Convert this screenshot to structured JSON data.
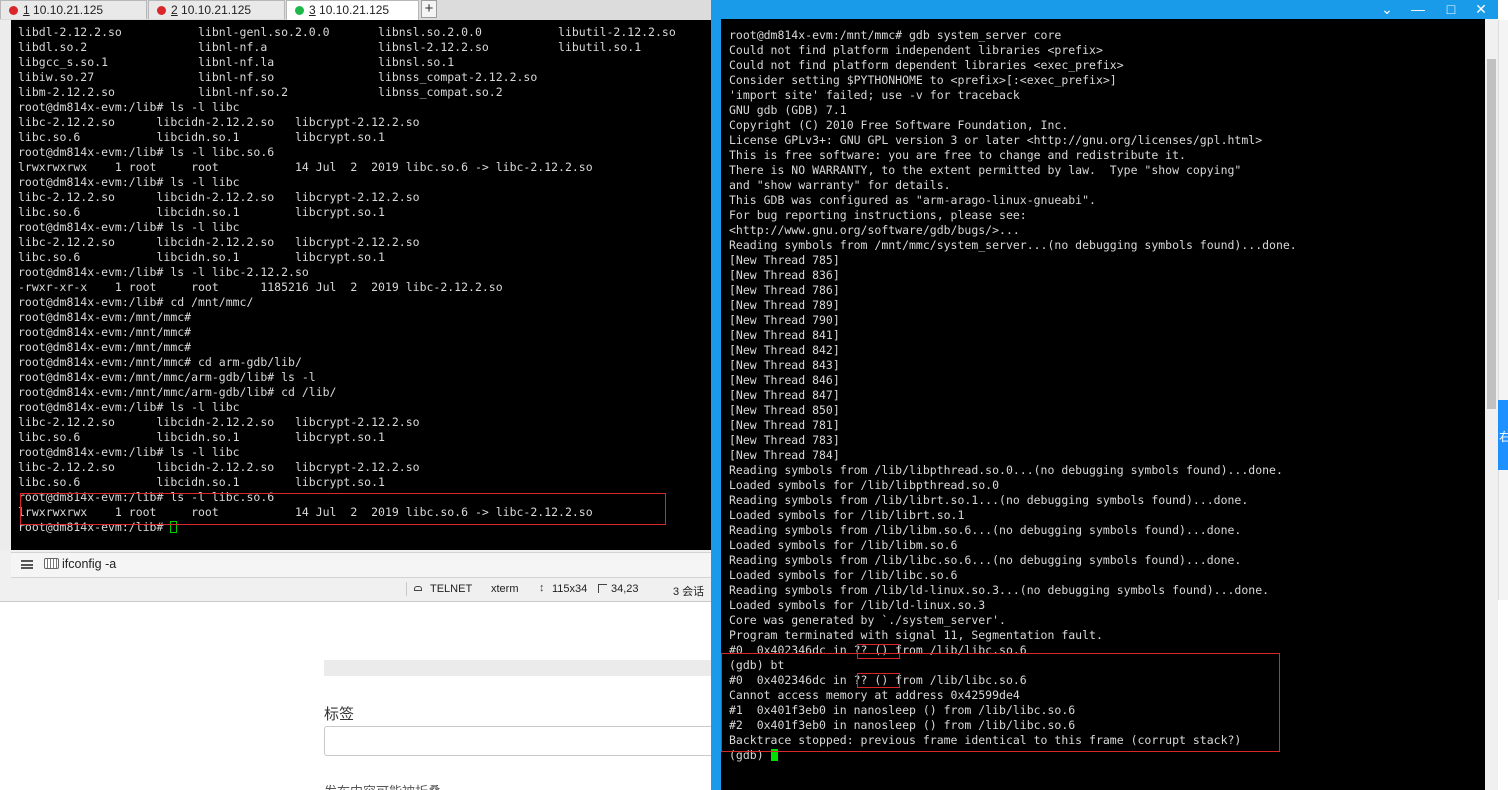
{
  "tabs": [
    {
      "number": "1",
      "label": "10.10.21.125",
      "status_color": "#d9262b"
    },
    {
      "number": "2",
      "label": "10.10.21.125",
      "status_color": "#d9262b"
    },
    {
      "number": "3",
      "label": "10.10.21.125",
      "status_color": "#1cb84a"
    }
  ],
  "tab_add_icon": "+",
  "left_terminal": {
    "lines": [
      "libdl-2.12.2.so           libnl-genl.so.2.0.0       libnsl.so.2.0.0           libutil-2.12.2.so",
      "libdl.so.2                libnl-nf.a                libnsl-2.12.2.so          libutil.so.1",
      "libgcc_s.so.1             libnl-nf.la               libnsl.so.1",
      "libiw.so.27               libnl-nf.so               libnss_compat-2.12.2.so",
      "libm-2.12.2.so            libnl-nf.so.2             libnss_compat.so.2",
      "root@dm814x-evm:/lib# ls -l libc",
      "libc-2.12.2.so      libcidn-2.12.2.so   libcrypt-2.12.2.so",
      "libc.so.6           libcidn.so.1        libcrypt.so.1",
      "root@dm814x-evm:/lib# ls -l libc.so.6",
      "lrwxrwxrwx    1 root     root           14 Jul  2  2019 libc.so.6 -> libc-2.12.2.so",
      "root@dm814x-evm:/lib# ls -l libc",
      "libc-2.12.2.so      libcidn-2.12.2.so   libcrypt-2.12.2.so",
      "libc.so.6           libcidn.so.1        libcrypt.so.1",
      "root@dm814x-evm:/lib# ls -l libc",
      "libc-2.12.2.so      libcidn-2.12.2.so   libcrypt-2.12.2.so",
      "libc.so.6           libcidn.so.1        libcrypt.so.1",
      "root@dm814x-evm:/lib# ls -l libc-2.12.2.so",
      "-rwxr-xr-x    1 root     root      1185216 Jul  2  2019 libc-2.12.2.so",
      "root@dm814x-evm:/lib# cd /mnt/mmc/",
      "root@dm814x-evm:/mnt/mmc#",
      "root@dm814x-evm:/mnt/mmc#",
      "root@dm814x-evm:/mnt/mmc#",
      "root@dm814x-evm:/mnt/mmc# cd arm-gdb/lib/",
      "root@dm814x-evm:/mnt/mmc/arm-gdb/lib# ls -l",
      "root@dm814x-evm:/mnt/mmc/arm-gdb/lib# cd /lib/",
      "root@dm814x-evm:/lib# ls -l libc",
      "libc-2.12.2.so      libcidn-2.12.2.so   libcrypt-2.12.2.so",
      "libc.so.6           libcidn.so.1        libcrypt.so.1",
      "root@dm814x-evm:/lib# ls -l libc",
      "libc-2.12.2.so      libcidn-2.12.2.so   libcrypt-2.12.2.so",
      "libc.so.6           libcidn.so.1        libcrypt.so.1",
      "root@dm814x-evm:/lib# ls -l libc.so.6",
      "lrwxrwxrwx    1 root     root           14 Jul  2  2019 libc.so.6 -> libc-2.12.2.so"
    ],
    "prompt": "root@dm814x-evm:/lib# "
  },
  "command_bar": {
    "text": "ifconfig -a"
  },
  "status_bar": {
    "protocol": "TELNET",
    "terminal_type": "xterm",
    "size": "115x34",
    "cursor_pos": "34,23",
    "sessions": "3 会话"
  },
  "right_terminal": {
    "lines": [
      "root@dm814x-evm:/mnt/mmc# gdb system_server core",
      "Could not find platform independent libraries <prefix>",
      "Could not find platform dependent libraries <exec_prefix>",
      "Consider setting $PYTHONHOME to <prefix>[:<exec_prefix>]",
      "'import site' failed; use -v for traceback",
      "GNU gdb (GDB) 7.1",
      "Copyright (C) 2010 Free Software Foundation, Inc.",
      "License GPLv3+: GNU GPL version 3 or later <http://gnu.org/licenses/gpl.html>",
      "This is free software: you are free to change and redistribute it.",
      "There is NO WARRANTY, to the extent permitted by law.  Type \"show copying\"",
      "and \"show warranty\" for details.",
      "This GDB was configured as \"arm-arago-linux-gnueabi\".",
      "For bug reporting instructions, please see:",
      "<http://www.gnu.org/software/gdb/bugs/>...",
      "Reading symbols from /mnt/mmc/system_server...(no debugging symbols found)...done.",
      "[New Thread 785]",
      "[New Thread 836]",
      "[New Thread 786]",
      "[New Thread 789]",
      "[New Thread 790]",
      "[New Thread 841]",
      "[New Thread 842]",
      "[New Thread 843]",
      "[New Thread 846]",
      "[New Thread 847]",
      "[New Thread 850]",
      "[New Thread 781]",
      "[New Thread 783]",
      "[New Thread 784]",
      "Reading symbols from /lib/libpthread.so.0...(no debugging symbols found)...done.",
      "Loaded symbols for /lib/libpthread.so.0",
      "Reading symbols from /lib/librt.so.1...(no debugging symbols found)...done.",
      "Loaded symbols for /lib/librt.so.1",
      "Reading symbols from /lib/libm.so.6...(no debugging symbols found)...done.",
      "Loaded symbols for /lib/libm.so.6",
      "Reading symbols from /lib/libc.so.6...(no debugging symbols found)...done.",
      "Loaded symbols for /lib/libc.so.6",
      "Reading symbols from /lib/ld-linux.so.3...(no debugging symbols found)...done.",
      "Loaded symbols for /lib/ld-linux.so.3",
      "Core was generated by `./system_server'.",
      "Program terminated with signal 11, Segmentation fault.",
      "#0  0x402346dc in ?? () from /lib/libc.so.6",
      "(gdb) bt",
      "#0  0x402346dc in ?? () from /lib/libc.so.6",
      "Cannot access memory at address 0x42599de4",
      "#1  0x401f3eb0 in nanosleep () from /lib/libc.so.6",
      "#2  0x401f3eb0 in nanosleep () from /lib/libc.so.6",
      "Backtrace stopped: previous frame identical to this frame (corrupt stack?)"
    ],
    "prompt": "(gdb) "
  },
  "background_page": {
    "tag_label": "标签",
    "bottom_text": "发布内容可能被折叠"
  },
  "right_edge_text": "右",
  "window_controls": {
    "collapse": "⌄",
    "minimize": "—",
    "maximize": "□",
    "close": "✕"
  },
  "colors": {
    "terminal_bg": "#000000",
    "terminal_fg": "#d9d9d9",
    "highlight_red": "#d9262b",
    "cursor_green": "#00e000",
    "title_blue": "#1a9bea"
  }
}
